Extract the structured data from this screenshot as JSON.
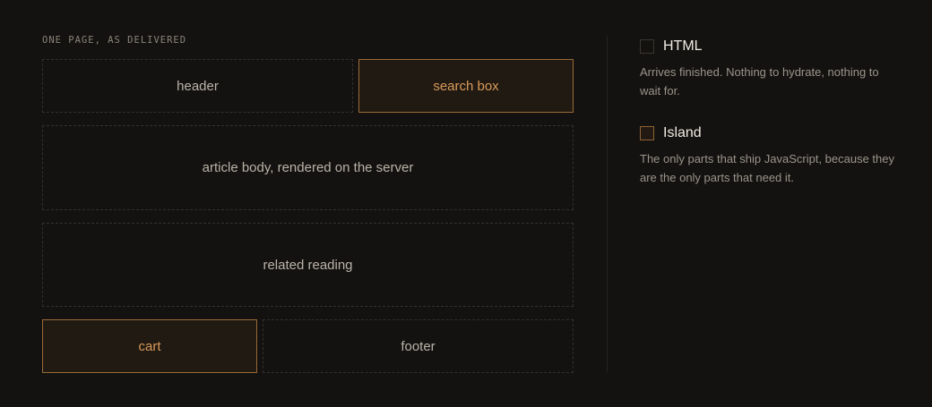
{
  "diagram": {
    "caption": "ONE PAGE, AS DELIVERED",
    "blocks": [
      {
        "label": "header",
        "kind": "html"
      },
      {
        "label": "search box",
        "kind": "island"
      },
      {
        "label": "article body, rendered on the server",
        "kind": "html"
      },
      {
        "label": "related reading",
        "kind": "html"
      },
      {
        "label": "cart",
        "kind": "island"
      },
      {
        "label": "footer",
        "kind": "html"
      }
    ]
  },
  "legend": {
    "items": [
      {
        "title": "HTML",
        "description": "Arrives finished. Nothing to hydrate, nothing to wait for."
      },
      {
        "title": "Island",
        "description": "The only parts that ship JavaScript, because they are the only parts that need it."
      }
    ]
  },
  "colors": {
    "background": "#141210",
    "island_border": "#9a6a36",
    "island_fill": "#211a13",
    "island_text": "#d99a58",
    "html_border": "#33302b"
  }
}
